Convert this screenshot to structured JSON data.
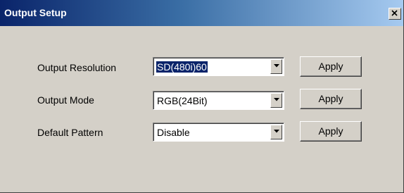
{
  "window": {
    "title": "Output Setup",
    "close_icon": "close-x-icon"
  },
  "rows": [
    {
      "label": "Output Resolution",
      "value": "SD(480i)60",
      "value_selected": true,
      "apply_label": "Apply"
    },
    {
      "label": "Output Mode",
      "value": "RGB(24Bit)",
      "value_selected": false,
      "apply_label": "Apply"
    },
    {
      "label": "Default Pattern",
      "value": "Disable",
      "value_selected": false,
      "apply_label": "Apply"
    }
  ],
  "colors": {
    "titlebar_start": "#0a246a",
    "titlebar_end": "#a6caf0",
    "dialog_background": "#d4d0c8",
    "selection_highlight": "#0a246a"
  }
}
